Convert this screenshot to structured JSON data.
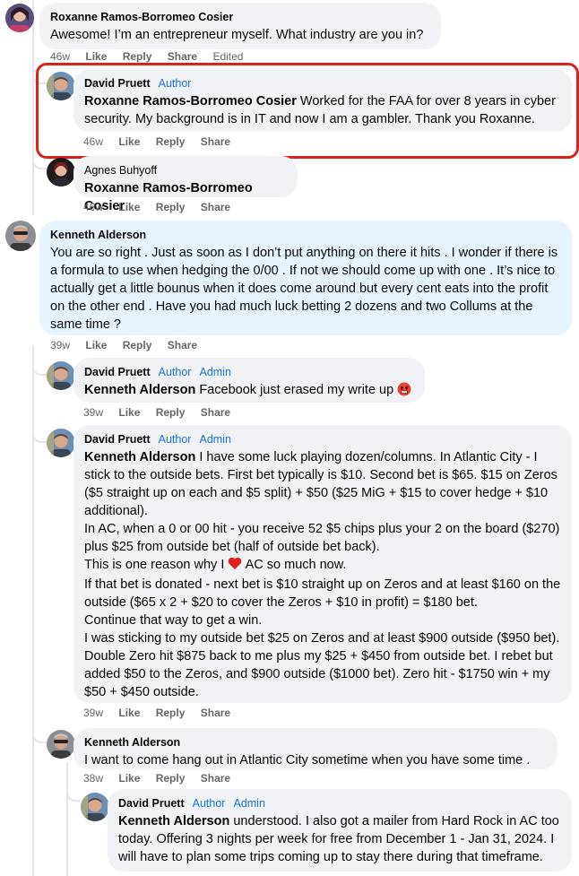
{
  "comments": [
    {
      "author": "Roxanne Ramos-Borromeo Cosier",
      "badges": [],
      "text": "Awesome! I’m an entrepreneur myself. What industry are you in?",
      "time": "46w",
      "like": "Like",
      "reply": "Reply",
      "share": "Share",
      "edited": "Edited"
    },
    {
      "author": "David Pruett",
      "badges": [
        "Author"
      ],
      "mention": "Roxanne Ramos-Borromeo Cosier",
      "text": " Worked for the FAA for over 8 years in cyber security. My background is in IT and now I am a gambler. Thank you Roxanne.",
      "time": "46w",
      "like": "Like",
      "reply": "Reply",
      "share": "Share"
    },
    {
      "author": "Agnes Buhyoff",
      "badges": [],
      "mention": "Roxanne Ramos-Borromeo Cosier",
      "text": "",
      "time": "46w",
      "like": "Like",
      "reply": "Reply",
      "share": "Share"
    },
    {
      "author": "Kenneth Alderson",
      "badges": [],
      "text": "You are so right . Just as soon as I don’t put anything on there it hits . I wonder if there is a formula to use when hedging the 0/00 . If not we should come up with one . It’s nice to actually get a little bounus when it does come around but every cent eats into the profit on the other end . Have you had much luck betting 2 dozens and two Collums at the same time ?",
      "time": "39w",
      "like": "Like",
      "reply": "Reply",
      "share": "Share"
    },
    {
      "author": "David Pruett",
      "badges": [
        "Author",
        "Admin"
      ],
      "mention": "Kenneth Alderson",
      "text": " Facebook just erased my write up",
      "time": "39w",
      "like": "Like",
      "reply": "Reply",
      "share": "Share"
    },
    {
      "author": "David Pruett",
      "badges": [
        "Author",
        "Admin"
      ],
      "mention": "Kenneth Alderson",
      "paragraphs": [
        " I have some luck playing dozen/columns. In Atlantic City - I stick to the outside bets. First bet typically is $10. Second bet is $65. $15 on Zeros ($5 straight up on each and $5 split) + $50 ($25 MiG + $15 to cover hedge + $10 additional).",
        "In AC, when a 0 or 00 hit - you receive 52 $5 chips plus your 2 on the board ($270) plus $25 from outside bet (half of outside bet back).",
        "This is one reason why I",
        " AC so much now.",
        "If that bet is donated - next bet is $10 straight up on Zeros and at least $160 on the outside ($65 x 2 + $20 to cover the Zeros + $10 in profit) = $180 bet.",
        "Continue that way to get a win.",
        "I was sticking to my outside bet $25 on Zeros and at least $900 outside ($950 bet). Double Zero hit $875 back to me plus my $25 + $450 from outside bet. I rebet but added $50 to the Zeros, and $900 outside ($1000 bet). Zero hit - $1750 win + my $50 + $450 outside."
      ],
      "time": "39w",
      "like": "Like",
      "reply": "Reply",
      "share": "Share"
    },
    {
      "author": "Kenneth Alderson",
      "badges": [],
      "text": "I want to come hang out in Atlantic City sometime when you have some time .",
      "time": "38w",
      "like": "Like",
      "reply": "Reply",
      "share": "Share"
    },
    {
      "author": "David Pruett",
      "badges": [
        "Author",
        "Admin"
      ],
      "mention": "Kenneth Alderson",
      "text": " understood. I also got a mailer from Hard Rock in AC too today. Offering 3 nights per week for free from December 1 - Jan 31, 2024. I will have to plan some trips coming up to stay there during that timeframe."
    }
  ],
  "icons": {
    "heart": "heart-emoji-icon",
    "angry": "angry-face-emoji-icon"
  },
  "colors": {
    "highlight_box": "#e0201c",
    "badge": "#1b74e4",
    "bubble": "#f0f2f5",
    "bubble_highlight": "#e7f3ff"
  }
}
